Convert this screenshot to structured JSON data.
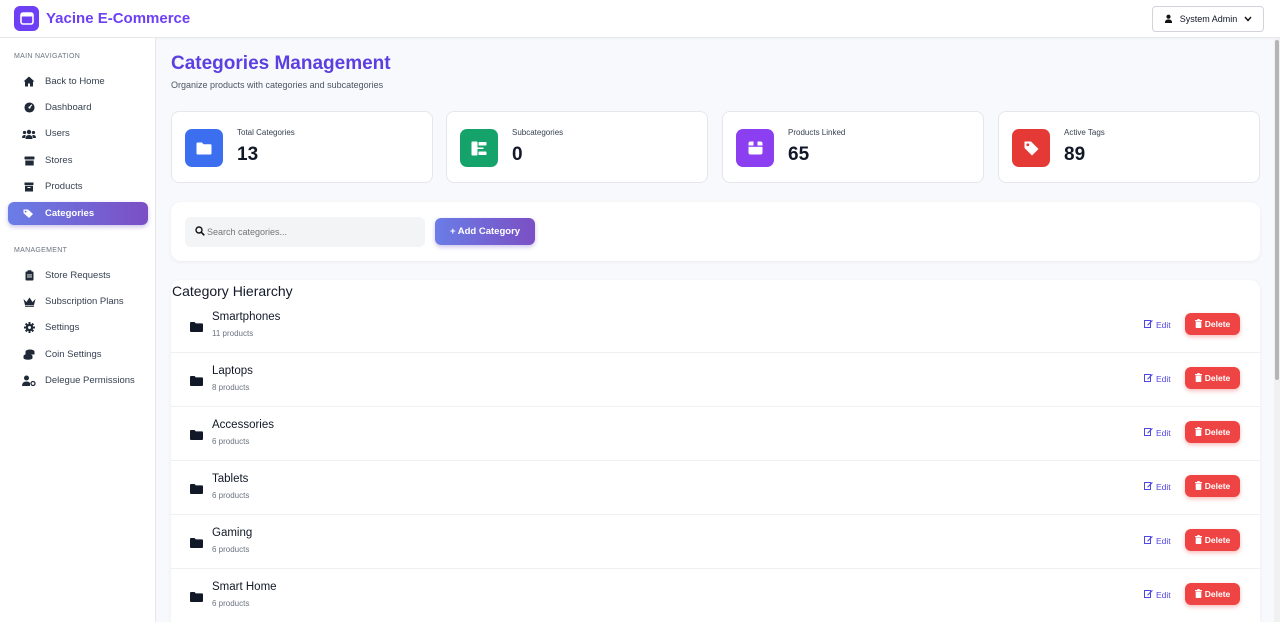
{
  "app": {
    "title": "Yacine E-Commerce",
    "brand_color": "#6d3ff5"
  },
  "user_menu": {
    "label": "System Admin",
    "icon": "user-icon"
  },
  "sidebar": {
    "main_title": "MAIN NAVIGATION",
    "main_items": [
      {
        "label": "Back to Home",
        "icon": "home-icon"
      },
      {
        "label": "Dashboard",
        "icon": "gauge-icon"
      },
      {
        "label": "Users",
        "icon": "users-icon"
      },
      {
        "label": "Stores",
        "icon": "store-icon"
      },
      {
        "label": "Products",
        "icon": "box-icon"
      },
      {
        "label": "Categories",
        "icon": "tags-icon",
        "active": true
      }
    ],
    "management_title": "MANAGEMENT",
    "management_items": [
      {
        "label": "Store Requests",
        "icon": "clipboard-icon"
      },
      {
        "label": "Subscription Plans",
        "icon": "crown-icon"
      },
      {
        "label": "Settings",
        "icon": "gear-icon"
      },
      {
        "label": "Coin Settings",
        "icon": "coins-icon"
      },
      {
        "label": "Delegue Permissions",
        "icon": "user-key-icon"
      }
    ]
  },
  "header": {
    "title": "Categories Management",
    "subtitle": "Organize products with categories and subcategories"
  },
  "stats": [
    {
      "label": "Total Categories",
      "value": "13",
      "icon": "folder-icon",
      "color": "#3b6ff0"
    },
    {
      "label": "Subcategories",
      "value": "0",
      "icon": "sitemap-icon",
      "color": "#16a36b"
    },
    {
      "label": "Products Linked",
      "value": "65",
      "icon": "box-open-icon",
      "color": "#8b3ff0"
    },
    {
      "label": "Active Tags",
      "value": "89",
      "icon": "tag-icon",
      "color": "#e53935"
    }
  ],
  "toolbar": {
    "search_placeholder": "Search categories...",
    "add_label": "+ Add Category"
  },
  "hierarchy": {
    "title": "Category Hierarchy",
    "edit_label": "Edit",
    "delete_label": "Delete",
    "items": [
      {
        "name": "Smartphones",
        "count": "11 products"
      },
      {
        "name": "Laptops",
        "count": "8 products"
      },
      {
        "name": "Accessories",
        "count": "6 products"
      },
      {
        "name": "Tablets",
        "count": "6 products"
      },
      {
        "name": "Gaming",
        "count": "6 products"
      },
      {
        "name": "Smart Home",
        "count": "6 products"
      }
    ]
  }
}
